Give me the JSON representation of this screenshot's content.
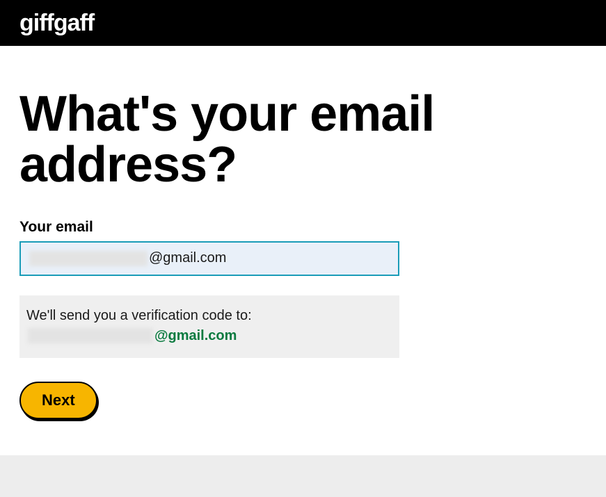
{
  "header": {
    "logo_text": "giffgaff"
  },
  "main": {
    "heading": "What's your email address?",
    "email_label": "Your email",
    "email_value_suffix": "@gmail.com",
    "verify_text": "We'll send you a verification code to:",
    "verify_email_suffix": "@gmail.com",
    "next_button_label": "Next"
  }
}
